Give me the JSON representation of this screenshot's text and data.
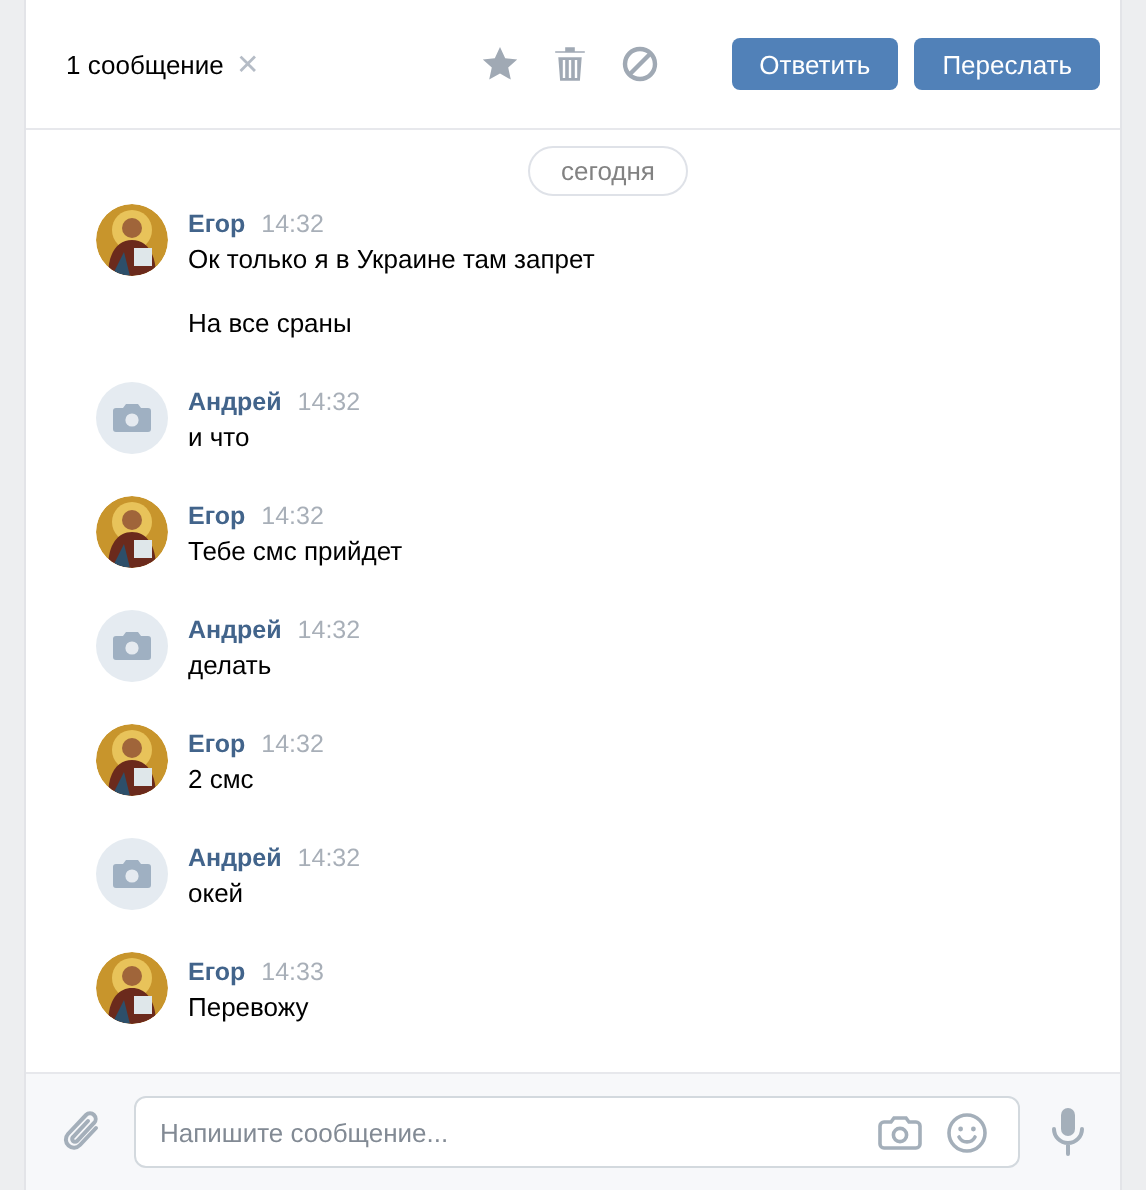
{
  "header": {
    "selection": "1 сообщение",
    "close": "✕",
    "buttons": [
      "Ответить",
      "Переслать"
    ]
  },
  "date_divider": "сегодня",
  "messages": [
    {
      "author": "Егор",
      "time": "14:32",
      "avatar": {
        "kind": "picture"
      },
      "texts": [
        "Ок только я в Украине там запрет",
        "На все сраны"
      ]
    },
    {
      "author": "Андрей",
      "time": "14:32",
      "avatar": {
        "kind": "placeholder"
      },
      "texts": [
        "и что"
      ]
    },
    {
      "author": "Егор",
      "time": "14:32",
      "avatar": {
        "kind": "picture"
      },
      "texts": [
        "Тебе смс прийдет"
      ]
    },
    {
      "author": "Андрей",
      "time": "14:32",
      "avatar": {
        "kind": "placeholder"
      },
      "texts": [
        "делать"
      ]
    },
    {
      "author": "Егор",
      "time": "14:32",
      "avatar": {
        "kind": "picture"
      },
      "texts": [
        "2 смс"
      ]
    },
    {
      "author": "Андрей",
      "time": "14:32",
      "avatar": {
        "kind": "placeholder"
      },
      "texts": [
        "окей"
      ]
    },
    {
      "author": "Егор",
      "time": "14:33",
      "avatar": {
        "kind": "picture"
      },
      "texts": [
        "Перевожу"
      ]
    }
  ],
  "composer": {
    "placeholder": "Напишите сообщение..."
  }
}
